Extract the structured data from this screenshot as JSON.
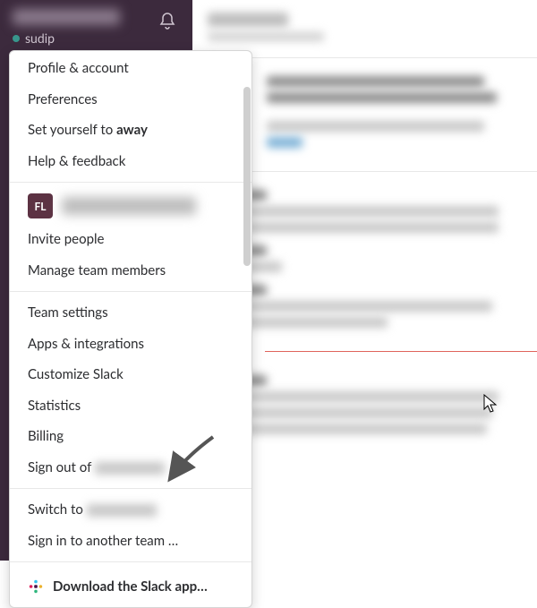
{
  "sidebar": {
    "workspace_name": "(redacted)",
    "username": "sudip"
  },
  "menu": {
    "profile": "Profile & account",
    "preferences": "Preferences",
    "set_away_prefix": "Set yourself to ",
    "set_away_bold": "away",
    "help": "Help & feedback",
    "team_avatar_initials": "FL",
    "team_name": "(redacted)",
    "invite": "Invite people",
    "manage_members": "Manage team members",
    "team_settings": "Team settings",
    "apps": "Apps & integrations",
    "customize": "Customize Slack",
    "statistics": "Statistics",
    "billing": "Billing",
    "sign_out_prefix": "Sign out of ",
    "sign_out_team": "(redacted)",
    "switch_to_prefix": "Switch to ",
    "switch_to_team": "(redacted)",
    "sign_in_another": "Sign in to another team …",
    "download": "Download the Slack app…"
  },
  "colors": {
    "sidebar_bg": "#3c2a3d",
    "presence_active": "#38978d",
    "unread_divider": "#e0645c"
  }
}
